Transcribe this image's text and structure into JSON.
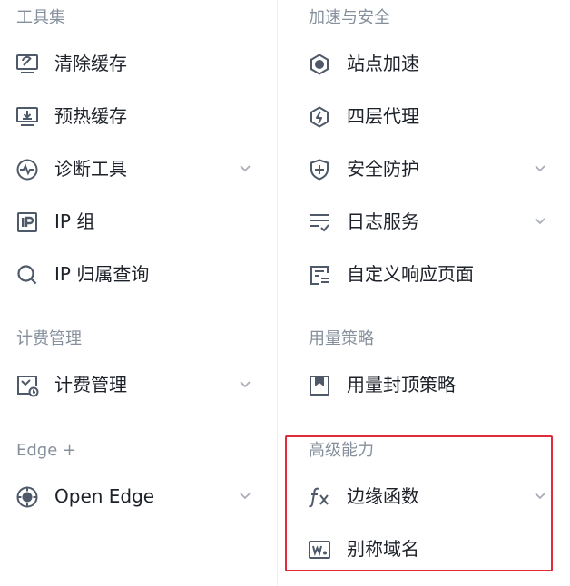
{
  "left": {
    "groups": [
      {
        "title": "工具集",
        "items": [
          {
            "label": "清除缓存",
            "icon": "clear-cache-icon",
            "expandable": false
          },
          {
            "label": "预热缓存",
            "icon": "preheat-cache-icon",
            "expandable": false
          },
          {
            "label": "诊断工具",
            "icon": "diagnose-icon",
            "expandable": true
          },
          {
            "label": "IP 组",
            "icon": "ip-group-icon",
            "expandable": false
          },
          {
            "label": "IP 归属查询",
            "icon": "search-icon",
            "expandable": false
          }
        ]
      },
      {
        "title": "计费管理",
        "items": [
          {
            "label": "计费管理",
            "icon": "billing-icon",
            "expandable": true
          }
        ]
      },
      {
        "title": "Edge +",
        "items": [
          {
            "label": "Open Edge",
            "icon": "open-edge-icon",
            "expandable": true
          }
        ]
      }
    ]
  },
  "right": {
    "groups": [
      {
        "title": "加速与安全",
        "items": [
          {
            "label": "站点加速",
            "icon": "site-accel-icon",
            "expandable": false
          },
          {
            "label": "四层代理",
            "icon": "l4-proxy-icon",
            "expandable": false
          },
          {
            "label": "安全防护",
            "icon": "shield-icon",
            "expandable": true
          },
          {
            "label": "日志服务",
            "icon": "log-icon",
            "expandable": true
          },
          {
            "label": "自定义响应页面",
            "icon": "custom-page-icon",
            "expandable": false
          }
        ]
      },
      {
        "title": "用量策略",
        "items": [
          {
            "label": "用量封顶策略",
            "icon": "usage-cap-icon",
            "expandable": false
          }
        ]
      },
      {
        "title": "高级能力",
        "items": [
          {
            "label": "边缘函数",
            "icon": "fx-icon",
            "expandable": true
          },
          {
            "label": "别称域名",
            "icon": "alias-domain-icon",
            "expandable": false
          }
        ]
      }
    ]
  },
  "colors": {
    "text": "#1d2129",
    "muted": "#86909c",
    "icon": "#4e5969",
    "highlight": "#e02c3a"
  }
}
